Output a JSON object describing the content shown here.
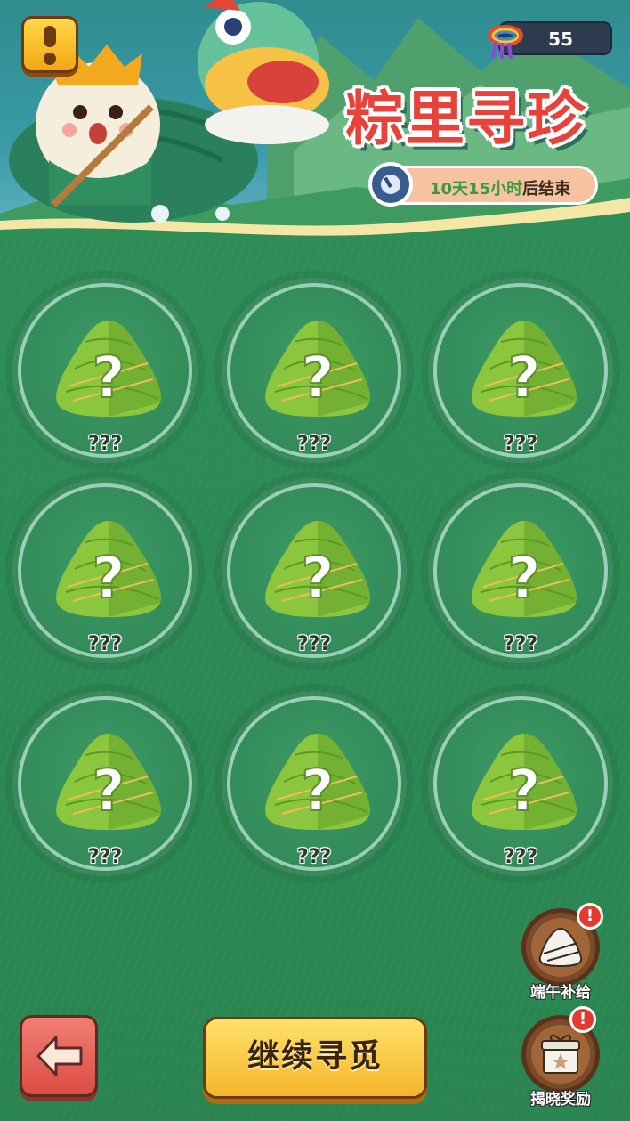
{
  "header": {
    "title": "粽里寻珍",
    "coins": "55",
    "timer": {
      "highlight": "10天15小时",
      "suffix": "后结束"
    }
  },
  "grid": {
    "items": [
      {
        "label": "???"
      },
      {
        "label": "???"
      },
      {
        "label": "???"
      },
      {
        "label": "???"
      },
      {
        "label": "???"
      },
      {
        "label": "???"
      },
      {
        "label": "???"
      },
      {
        "label": "???"
      },
      {
        "label": "???"
      }
    ]
  },
  "side": {
    "supply_label": "端午补给",
    "reward_label": "揭晓奖励",
    "badge": "!"
  },
  "footer": {
    "continue_label": "继续寻觅"
  },
  "colors": {
    "title": "#e8433b",
    "button": "#f5b52a",
    "back": "#dd4d45",
    "bg": "#2e8a56"
  }
}
